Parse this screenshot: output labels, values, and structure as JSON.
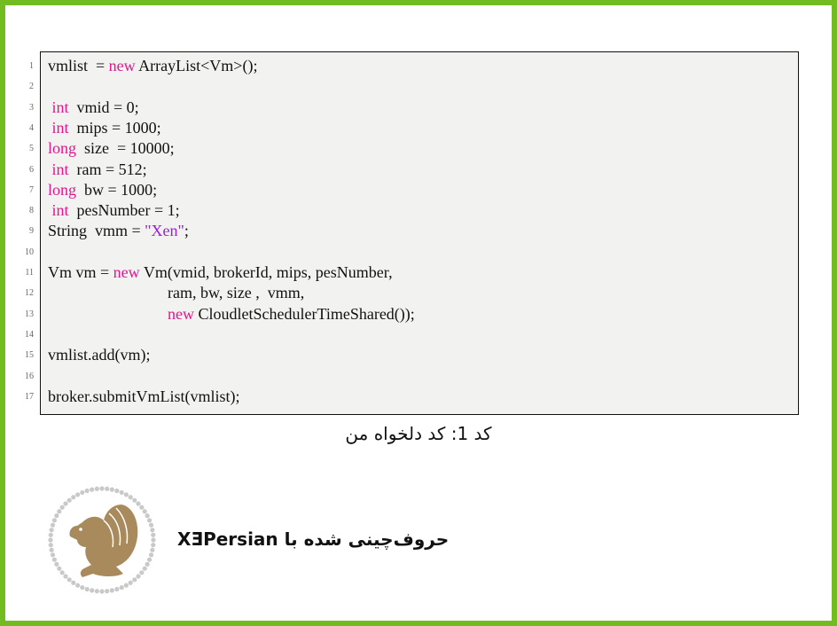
{
  "page": {
    "border_color": "#72bb21",
    "code_background": "#f2f3f1",
    "keyword_color": "#e2168d",
    "string_color": "#9a1fd6"
  },
  "code": {
    "lines": [
      {
        "n": "1",
        "parts": [
          [
            "t",
            "vmlist  = "
          ],
          [
            "kw",
            "new"
          ],
          [
            "t",
            " ArrayList<Vm>();"
          ]
        ]
      },
      {
        "n": "2",
        "parts": []
      },
      {
        "n": "3",
        "parts": [
          [
            "t",
            " "
          ],
          [
            "kw",
            "int"
          ],
          [
            "t",
            "  vmid = 0;"
          ]
        ]
      },
      {
        "n": "4",
        "parts": [
          [
            "t",
            " "
          ],
          [
            "kw",
            "int"
          ],
          [
            "t",
            "  mips = 1000;"
          ]
        ]
      },
      {
        "n": "5",
        "parts": [
          [
            "kw",
            "long"
          ],
          [
            "t",
            "  size  = 10000;"
          ]
        ]
      },
      {
        "n": "6",
        "parts": [
          [
            "t",
            " "
          ],
          [
            "kw",
            "int"
          ],
          [
            "t",
            "  ram = 512;"
          ]
        ]
      },
      {
        "n": "7",
        "parts": [
          [
            "kw",
            "long"
          ],
          [
            "t",
            "  bw = 1000;"
          ]
        ]
      },
      {
        "n": "8",
        "parts": [
          [
            "t",
            " "
          ],
          [
            "kw",
            "int"
          ],
          [
            "t",
            "  pesNumber = 1;"
          ]
        ]
      },
      {
        "n": "9",
        "parts": [
          [
            "t",
            "String  vmm = "
          ],
          [
            "str",
            "\"Xen\""
          ],
          [
            "t",
            ";"
          ]
        ]
      },
      {
        "n": "10",
        "parts": []
      },
      {
        "n": "11",
        "parts": [
          [
            "t",
            "Vm vm = "
          ],
          [
            "kw",
            "new"
          ],
          [
            "t",
            " Vm(vmid, brokerId, mips, pesNumber,"
          ]
        ]
      },
      {
        "n": "12",
        "parts": [
          [
            "t",
            "                              ram, bw, size ,  vmm,"
          ]
        ]
      },
      {
        "n": "13",
        "parts": [
          [
            "t",
            "                              "
          ],
          [
            "kw",
            "new"
          ],
          [
            "t",
            " CloudletSchedulerTimeShared());"
          ]
        ]
      },
      {
        "n": "14",
        "parts": []
      },
      {
        "n": "15",
        "parts": [
          [
            "t",
            "vmlist.add(vm);"
          ]
        ]
      },
      {
        "n": "16",
        "parts": []
      },
      {
        "n": "17",
        "parts": [
          [
            "t",
            "broker.submitVmList(vmlist);"
          ]
        ]
      }
    ]
  },
  "caption": "کد 1: کد دلخواه من",
  "footer": {
    "logo_icon": "persian-griffin-emblem-icon",
    "credit_text": "حروف‌چینی شده با XƎPersian"
  }
}
